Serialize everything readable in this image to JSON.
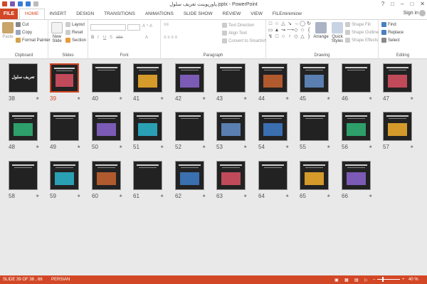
{
  "window": {
    "title": "پاورپوینت تعریف سلول.pptx - PowerPoint",
    "controls": [
      "?",
      "□",
      "–",
      "□",
      "✕"
    ]
  },
  "qat_icons": [
    "powerpoint-logo-icon",
    "save-icon",
    "undo-icon",
    "redo-icon",
    "customize-icon"
  ],
  "tabs": {
    "file": "FILE",
    "items": [
      "HOME",
      "INSERT",
      "DESIGN",
      "TRANSITIONS",
      "ANIMATIONS",
      "SLIDE SHOW",
      "REVIEW",
      "VIEW",
      "FILEminimizer"
    ],
    "active": "HOME",
    "signin": "Sign in"
  },
  "ribbon": {
    "clipboard": {
      "paste": "Paste",
      "cut": "Cut",
      "copy": "Copy",
      "format_painter": "Format Painter",
      "label": "Clipboard"
    },
    "slides": {
      "new_slide": "New Slide",
      "layout": "Layout",
      "reset": "Reset",
      "section": "Section",
      "label": "Slides"
    },
    "font": {
      "label": "Font"
    },
    "paragraph": {
      "text_direction": "Text Direction",
      "align_text": "Align Text",
      "convert_smartart": "Convert to SmartArt",
      "label": "Paragraph"
    },
    "drawing": {
      "arrange": "Arrange",
      "quick_styles": "Quick Styles",
      "shape_fill": "Shape Fill",
      "shape_outline": "Shape Outline",
      "shape_effects": "Shape Effects",
      "label": "Drawing"
    },
    "editing": {
      "find": "Find",
      "replace": "Replace",
      "select": "Select",
      "label": "Editing"
    }
  },
  "slides": [
    {
      "num": "38"
    },
    {
      "num": "39"
    },
    {
      "num": "40"
    },
    {
      "num": "41"
    },
    {
      "num": "42"
    },
    {
      "num": "43"
    },
    {
      "num": "44"
    },
    {
      "num": "45"
    },
    {
      "num": "46"
    },
    {
      "num": "47"
    },
    {
      "num": "48"
    },
    {
      "num": "49"
    },
    {
      "num": "50"
    },
    {
      "num": "51"
    },
    {
      "num": "52"
    },
    {
      "num": "53"
    },
    {
      "num": "54"
    },
    {
      "num": "55"
    },
    {
      "num": "56"
    },
    {
      "num": "57"
    },
    {
      "num": "58"
    },
    {
      "num": "59"
    },
    {
      "num": "60"
    },
    {
      "num": "61"
    },
    {
      "num": "62"
    },
    {
      "num": "63"
    },
    {
      "num": "64"
    },
    {
      "num": "65"
    },
    {
      "num": "66"
    }
  ],
  "selected_slide": "39",
  "slide_38_title": "تعریف سلول",
  "star": "★",
  "status": {
    "slide": "SLIDE 39 OF 38 , 66",
    "language": "PERSIAN",
    "zoom": "40 %"
  },
  "colors": {
    "accent": "#d24726"
  }
}
